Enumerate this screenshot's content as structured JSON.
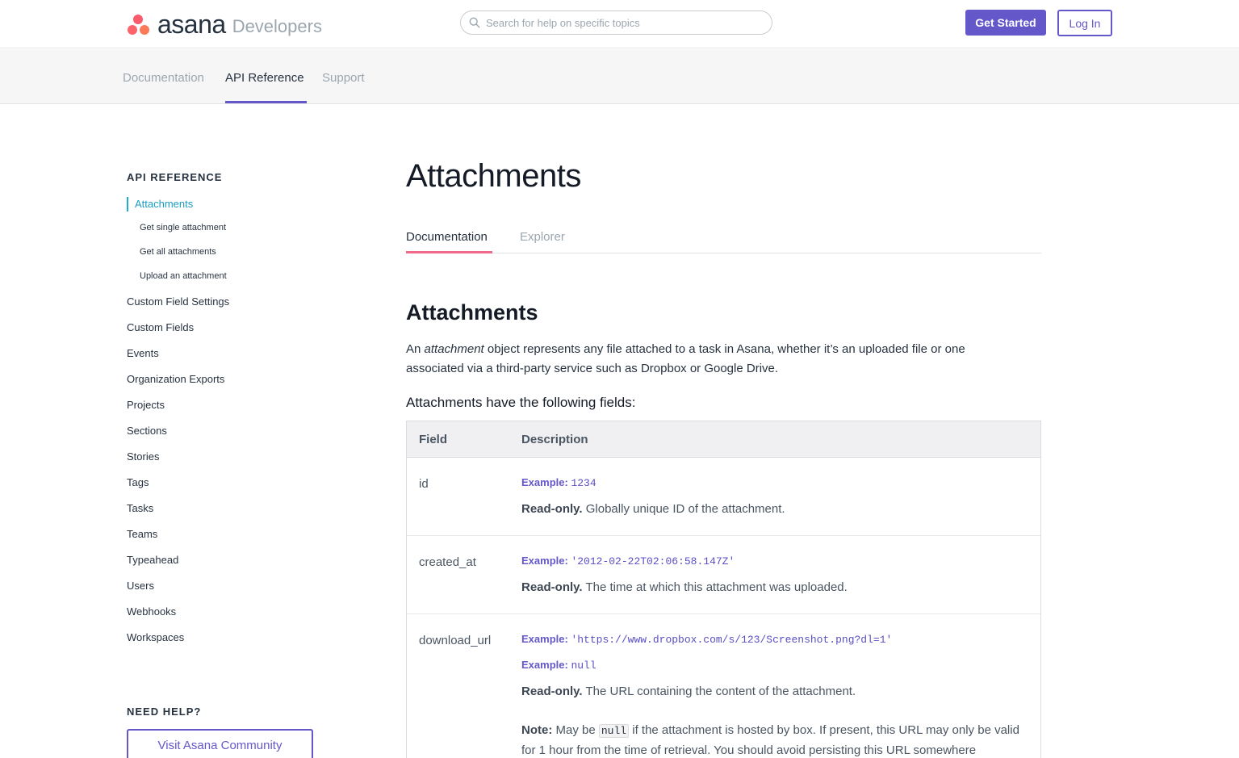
{
  "header": {
    "logo_word": "asana",
    "logo_sub": "Developers",
    "search_placeholder": "Search for help on specific topics",
    "get_started": "Get Started",
    "login": "Log In"
  },
  "subnav": {
    "items": [
      "Documentation",
      "API Reference",
      "Support"
    ],
    "active": "API Reference"
  },
  "sidebar": {
    "heading": "API REFERENCE",
    "active_item": "Attachments",
    "sub_items": [
      "Get single attachment",
      "Get all attachments",
      "Upload an attachment"
    ],
    "items": [
      "Custom Field Settings",
      "Custom Fields",
      "Events",
      "Organization Exports",
      "Projects",
      "Sections",
      "Stories",
      "Tags",
      "Tasks",
      "Teams",
      "Typeahead",
      "Users",
      "Webhooks",
      "Workspaces"
    ],
    "help_heading": "NEED HELP?",
    "community_button": "Visit Asana Community"
  },
  "main": {
    "title": "Attachments",
    "tabs": [
      "Documentation",
      "Explorer"
    ],
    "active_tab": "Documentation",
    "section_title": "Attachments",
    "intro_pre": "An ",
    "intro_em": "attachment",
    "intro_post": " object represents any file attached to a task in Asana, whether it’s an uploaded file or one associated via a third-party service such as Dropbox or Google Drive.",
    "fields_heading": "Attachments have the following fields:",
    "table": {
      "headers": [
        "Field",
        "Description"
      ],
      "rows": [
        {
          "field": "id",
          "examples": [
            "1234"
          ],
          "readonly": "Read-only.",
          "description": " Globally unique ID of the attachment."
        },
        {
          "field": "created_at",
          "examples": [
            "'2012-02-22T02:06:58.147Z'"
          ],
          "readonly": "Read-only.",
          "description": " The time at which this attachment was uploaded."
        },
        {
          "field": "download_url",
          "examples": [
            "'https://www.dropbox.com/s/123/Screenshot.png?dl=1'",
            "null"
          ],
          "readonly": "Read-only.",
          "description": " The URL containing the content of the attachment.",
          "note_label": "Note:",
          "note_pre": " May be ",
          "note_code": "null",
          "note_post": " if the attachment is hosted by box. If present, this URL may only be valid for 1 hour from the time of retrieval. You should avoid persisting this URL somewhere"
        }
      ],
      "example_label": "Example:"
    }
  },
  "colors": {
    "accent": "#6457c9",
    "tab_underline": "#f06a8a",
    "sidebar_active": "#1aafd0"
  }
}
